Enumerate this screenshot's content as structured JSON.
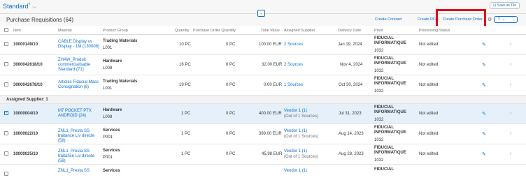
{
  "header": {
    "variant_title": "Standard",
    "variant_star": "*",
    "save_as_tile": "Save as Tile"
  },
  "table": {
    "title": "Purchase Requisitions (64)",
    "toolbar": {
      "create_contract": "Create Contract",
      "create_rfq": "Create RFQ",
      "create_po": "Create Purchase Order"
    },
    "columns": [
      "Item",
      "Material",
      "Product Group",
      "Quantity",
      "Purchase Order Quantity",
      "Total Value",
      "Assigned Supplier",
      "Delivery Date",
      "Plant",
      "Processing Status"
    ],
    "rows": [
      {
        "item": "10000149/10",
        "material": "CABLE Display vs Display - 1M (130008)",
        "pg_name": "Trading Materials",
        "pg_code": "L001",
        "qty": "10 PC",
        "po_qty": "0 PC",
        "total": "100.00 EUR",
        "supplier": "2 Sources",
        "date": "Jan 19, 2024",
        "plant_name": "FIDUCIAL INFORMATIQUE",
        "plant_code": "1032",
        "status": "Not edited"
      },
      {
        "item": "3000042618/10",
        "material": "ZHAW_Produit commercialisable Standard (71)",
        "pg_name": "Hardware",
        "pg_code": "L008",
        "qty": "16 PC",
        "po_qty": "0 PC",
        "total": "32.00 EUR",
        "supplier": "2 Sources",
        "date": "Nov 4, 2024",
        "plant_name": "FIDUCIAL INFORMATIQUE",
        "plant_code": "1032",
        "status": "Not edited"
      },
      {
        "item": "3000042678/10",
        "material": "Articles Fiducial Mass Consignation (6)",
        "pg_name": "Trading Materials",
        "pg_code": "L001",
        "qty": "19 PC",
        "po_qty": "0 PC",
        "total": "0.00 EUR",
        "supplier": "1 Sources",
        "date": "Oct 30, 2024",
        "plant_name": "FIDUCIAL INFORMATIQUE",
        "plant_code": "1032",
        "status": "Not edited"
      }
    ],
    "group_label": "Assigned Supplier: 1",
    "group_rows": [
      {
        "item": "10000004/10",
        "material": "M7 POCKET PTX ANDROID (24)",
        "pg_name": "Hardware",
        "pg_code": "L008",
        "qty": "1 PC",
        "po_qty": "0 PC",
        "total": "400.00 EUR",
        "supplier": "Vendor 1 (1)",
        "supplier_sub": "(Out of 1 Sources)",
        "date": "Jul 31, 2023",
        "plant_name": "FIDUCIAL INFORMATIQUE",
        "plant_code": "1032",
        "status": "Not edited",
        "selected": true
      },
      {
        "item": "10000022/10",
        "material": "ZNL1_Presta SS traitance Liv directe (58)",
        "pg_name": "Services",
        "pg_code": "P001",
        "qty": "1 PC",
        "po_qty": "0 PC",
        "total": "399.00 EUR",
        "supplier": "Vendor 1 (1)",
        "supplier_sub": "(Out of 1 Sources)",
        "date": "Aug 14, 2023",
        "plant_name": "FIDUCIAL INFORMATIQUE",
        "plant_code": "1032",
        "status": "Not edited",
        "selected": false
      },
      {
        "item": "10000025/10",
        "material": "ZNL1_Presta SS traitance Liv directe (58)",
        "pg_name": "Services",
        "pg_code": "P001",
        "qty": "1 PC",
        "po_qty": "0 PC",
        "total": "45.98 EUR",
        "supplier": "Vendor 1 (1)",
        "supplier_sub": "(Out of 1 Sources)",
        "date": "Aug 28, 2023",
        "plant_name": "FIDUCIAL INFORMATIQUE",
        "plant_code": "1032",
        "status": "Not edited",
        "selected": false
      },
      {
        "item": "",
        "material": "ZNL1_Presta SS",
        "pg_name": "Services",
        "pg_code": "",
        "qty": "",
        "po_qty": "",
        "total": "",
        "supplier": "Vendor 1 (1)",
        "supplier_sub": "",
        "date": "",
        "plant_name": "FIDUCIAL",
        "plant_code": "",
        "status": "",
        "selected": false
      }
    ]
  },
  "accent_color": "#0a6ed1",
  "highlight_color": "#e3001b"
}
